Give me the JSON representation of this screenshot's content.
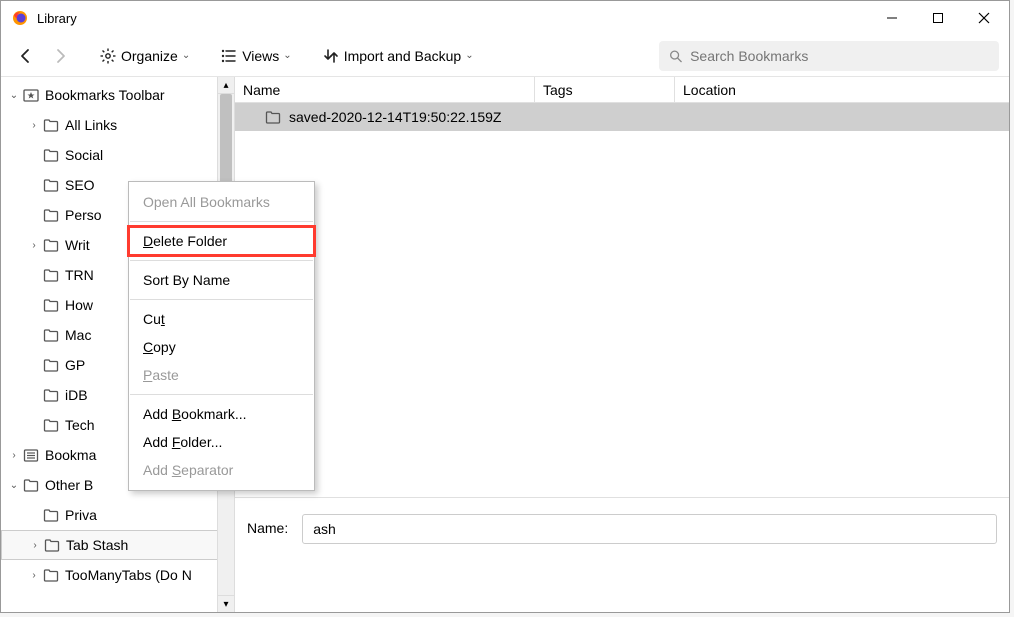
{
  "window": {
    "title": "Library"
  },
  "toolbar": {
    "organize": "Organize",
    "views": "Views",
    "import_backup": "Import and Backup"
  },
  "search": {
    "placeholder": "Search Bookmarks"
  },
  "sidebar": {
    "items": [
      {
        "label": "Bookmarks Toolbar",
        "indent": 0,
        "twisty": "open",
        "icon": "star-folder"
      },
      {
        "label": "All Links",
        "indent": 1,
        "twisty": "closed",
        "icon": "folder"
      },
      {
        "label": "Social",
        "indent": 1,
        "twisty": "blank",
        "icon": "folder"
      },
      {
        "label": "SEO",
        "indent": 1,
        "twisty": "blank",
        "icon": "folder"
      },
      {
        "label": "Perso",
        "indent": 1,
        "twisty": "blank",
        "icon": "folder"
      },
      {
        "label": "Writ",
        "indent": 1,
        "twisty": "closed",
        "icon": "folder"
      },
      {
        "label": "TRN",
        "indent": 1,
        "twisty": "blank",
        "icon": "folder"
      },
      {
        "label": "How",
        "indent": 1,
        "twisty": "blank",
        "icon": "folder"
      },
      {
        "label": "Mac",
        "indent": 1,
        "twisty": "blank",
        "icon": "folder"
      },
      {
        "label": "GP",
        "indent": 1,
        "twisty": "blank",
        "icon": "folder"
      },
      {
        "label": "iDB",
        "indent": 1,
        "twisty": "blank",
        "icon": "folder"
      },
      {
        "label": "Tech",
        "indent": 1,
        "twisty": "blank",
        "icon": "folder"
      },
      {
        "label": "Bookma",
        "indent": 0,
        "twisty": "closed",
        "icon": "menu-folder"
      },
      {
        "label": "Other B",
        "indent": 0,
        "twisty": "open",
        "icon": "folder"
      },
      {
        "label": "Priva",
        "indent": 1,
        "twisty": "blank",
        "icon": "folder"
      },
      {
        "label": "Tab Stash",
        "indent": 1,
        "twisty": "closed",
        "icon": "folder",
        "selected": true
      },
      {
        "label": "TooManyTabs (Do N",
        "indent": 1,
        "twisty": "closed",
        "icon": "folder"
      }
    ]
  },
  "columns": {
    "name": "Name",
    "tags": "Tags",
    "location": "Location"
  },
  "rows": [
    {
      "label": "saved-2020-12-14T19:50:22.159Z",
      "selected": true
    }
  ],
  "details": {
    "name_label": "Name:",
    "name_value": "ash"
  },
  "context_menu": {
    "items": [
      {
        "label": "Open All Bookmarks",
        "disabled": true,
        "u": -1
      },
      {
        "sep": true
      },
      {
        "label": "Delete Folder",
        "highlight": true,
        "u": 0
      },
      {
        "sep": true
      },
      {
        "label": "Sort By Name",
        "u": -1
      },
      {
        "sep": true
      },
      {
        "label": "Cut",
        "u": 2
      },
      {
        "label": "Copy",
        "u": 0
      },
      {
        "label": "Paste",
        "disabled": true,
        "u": 0
      },
      {
        "sep": true
      },
      {
        "label": "Add Bookmark...",
        "u": 4
      },
      {
        "label": "Add Folder...",
        "u": 4
      },
      {
        "label": "Add Separator",
        "disabled": true,
        "u": 4
      }
    ]
  }
}
